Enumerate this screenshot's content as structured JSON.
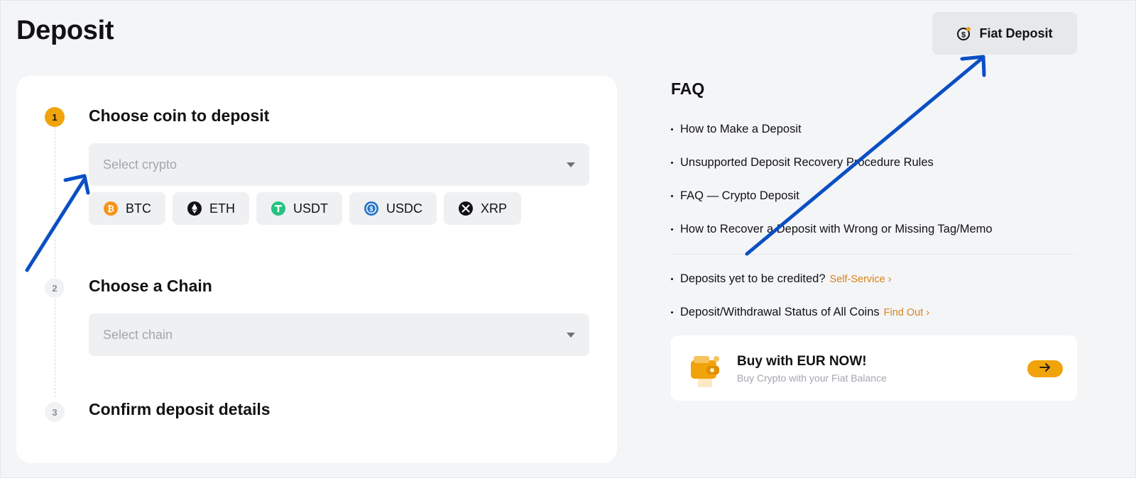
{
  "page": {
    "title": "Deposit",
    "fiat_button_label": "Fiat Deposit"
  },
  "steps": [
    {
      "number": "1",
      "title": "Choose coin to deposit",
      "placeholder": "Select crypto"
    },
    {
      "number": "2",
      "title": "Choose a Chain",
      "placeholder": "Select chain"
    },
    {
      "number": "3",
      "title": "Confirm deposit details"
    }
  ],
  "coins": [
    {
      "symbol": "BTC",
      "icon": "btc-icon",
      "color": "#f7931a"
    },
    {
      "symbol": "ETH",
      "icon": "eth-icon",
      "color": "#121214"
    },
    {
      "symbol": "USDT",
      "icon": "usdt-icon",
      "color": "#26c281"
    },
    {
      "symbol": "USDC",
      "icon": "usdc-icon",
      "color": "#2775ca"
    },
    {
      "symbol": "XRP",
      "icon": "xrp-icon",
      "color": "#121214"
    }
  ],
  "faq": {
    "title": "FAQ",
    "items": [
      "How to Make a Deposit",
      "Unsupported Deposit Recovery Procedure Rules",
      "FAQ — Crypto Deposit",
      "How to Recover a Deposit with Wrong or Missing Tag/Memo"
    ],
    "status_items": [
      {
        "text": "Deposits yet to be credited?",
        "link": "Self-Service"
      },
      {
        "text": "Deposit/Withdrawal Status of All Coins",
        "link": "Find Out"
      }
    ]
  },
  "promo": {
    "title": "Buy with EUR NOW!",
    "subtitle": "Buy Crypto with your Fiat Balance"
  },
  "colors": {
    "accent": "#f0a30a",
    "link": "#d9821a",
    "annotation_arrow": "#0a4fc4"
  }
}
